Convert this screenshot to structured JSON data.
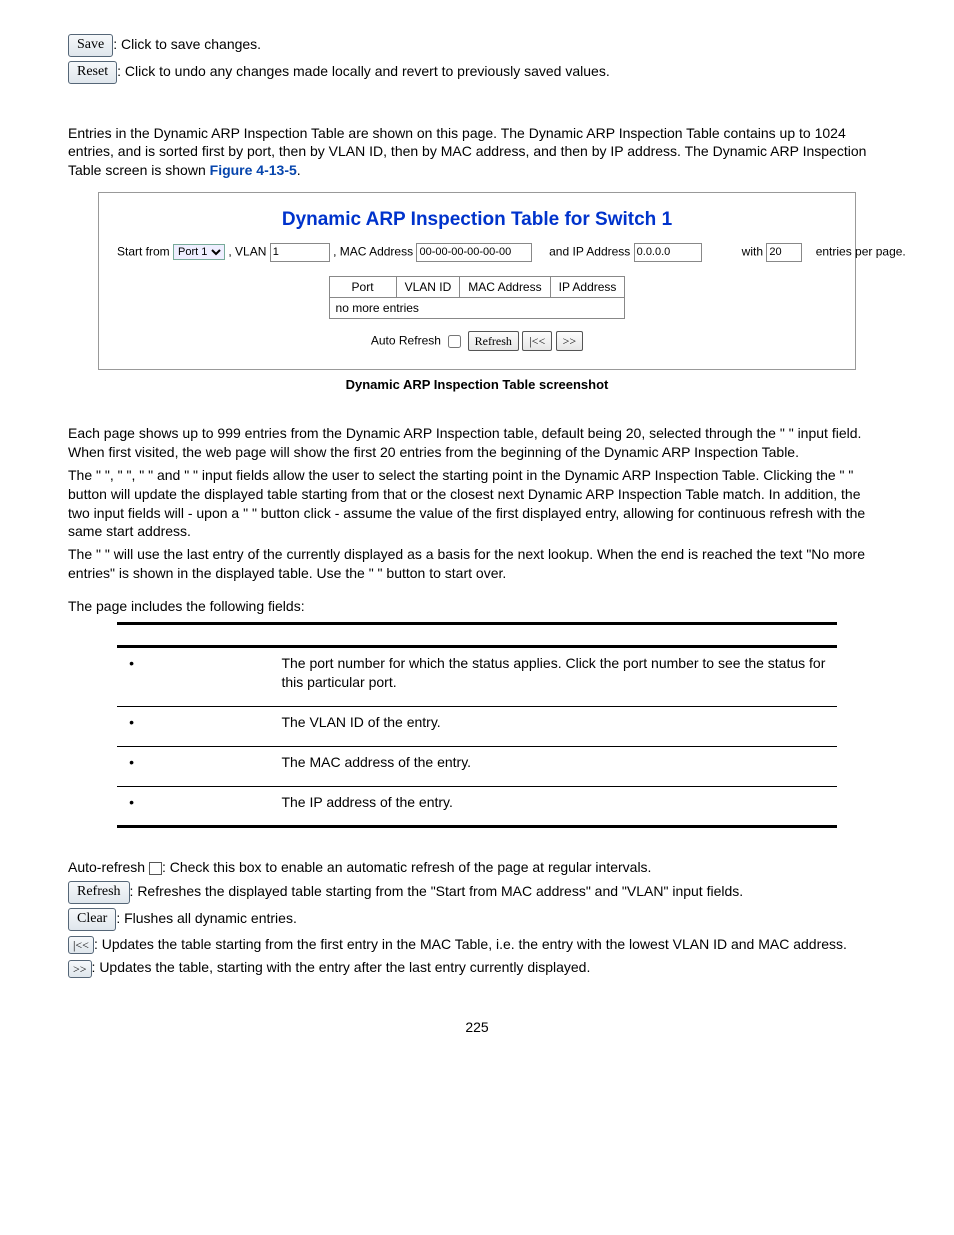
{
  "buttons": {
    "save": "Save",
    "reset": "Reset",
    "refresh_big": "Refresh",
    "clear": "Clear",
    "first": "|<<",
    "next": ">>"
  },
  "top": {
    "save_desc": ": Click to save changes.",
    "reset_desc": ": Click to undo any changes made locally and revert to previously saved values."
  },
  "intro": "Entries in the Dynamic ARP Inspection Table are shown on this page. The Dynamic ARP Inspection Table contains up to 1024 entries, and is sorted first by port, then by VLAN ID, then by MAC address, and then by IP address. The Dynamic ARP Inspection Table screen is shown ",
  "intro_link": "Figure 4-13-5",
  "panel": {
    "title": "Dynamic ARP Inspection Table for Switch 1",
    "start_from": "Start from",
    "port_value": "Port 1",
    "vlan_label": ", VLAN",
    "vlan_value": "1",
    "mac_label": ", MAC Address",
    "mac_value": "00-00-00-00-00-00",
    "ip_label": "and IP Address",
    "ip_value": "0.0.0.0",
    "with_label": "with",
    "with_value": "20",
    "epp": "entries per page.",
    "cols": {
      "port": "Port",
      "vlan": "VLAN ID",
      "mac": "MAC Address",
      "ip": "IP Address"
    },
    "no_more": "no more entries",
    "auto_refresh": "Auto Refresh",
    "refresh_btn": "Refresh",
    "first_btn": "|<<",
    "next_btn": ">>"
  },
  "caption": "Dynamic ARP Inspection Table screenshot",
  "nav": {
    "p1": "Each page shows up to 999 entries from the Dynamic ARP Inspection table, default being 20, selected through the \"             \" input field. When first visited, the web page will show the first 20 entries from the beginning of the Dynamic ARP Inspection Table.",
    "p2": "The \"                                    \", \"            \", \"                           \" and \"                    \" input fields allow the user to select the starting point in the Dynamic ARP Inspection Table. Clicking the \"              \" button will update the displayed table starting from that or the closest next Dynamic ARP Inspection Table match. In addition, the two input fields will - upon a \"              \" button click - assume the value of the first displayed entry, allowing for continuous refresh with the same start address.",
    "p3": "The \"     \" will use the last entry of the currently displayed as a basis for the next lookup. When the end is reached the text \"No more entries\" is shown in the displayed table. Use the \"     \" button to start over."
  },
  "fields_heading": "The page includes the following fields:",
  "fields": {
    "port": "The port number for which the status applies. Click the port number to see the status for this particular port.",
    "vlan": "The VLAN ID of the entry.",
    "mac": "The MAC address of the entry.",
    "ip": "The IP address of the entry."
  },
  "bottom": {
    "auto": "Auto-refresh ",
    "auto_desc": ": Check this box to enable an automatic refresh of the page at regular intervals.",
    "refresh_desc": ": Refreshes the displayed table starting from the \"Start from MAC address\" and \"VLAN\" input fields.",
    "clear_desc": ": Flushes all dynamic entries.",
    "first_desc": ": Updates the table starting from the first entry in the MAC Table, i.e. the entry with the lowest VLAN ID and MAC address.",
    "next_desc": ": Updates the table, starting with the entry after the last entry currently displayed."
  },
  "page_number": "225"
}
